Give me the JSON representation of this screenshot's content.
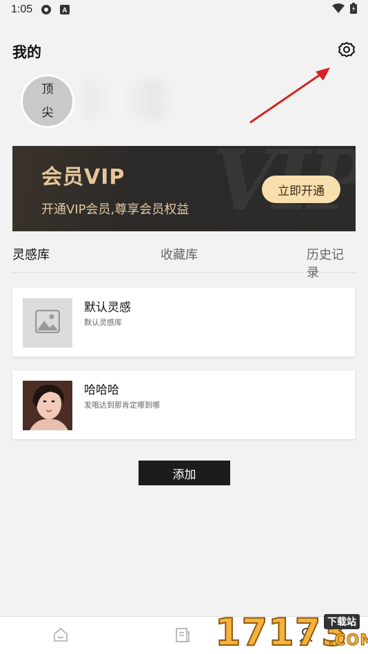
{
  "status_bar": {
    "time": "1:05",
    "icons": [
      "settings-gear-status-icon",
      "a-box-status-icon"
    ],
    "right_icons": [
      "wifi-icon",
      "battery-icon"
    ]
  },
  "header": {
    "title": "我的",
    "settings_icon": "gear-icon"
  },
  "profile": {
    "avatar_text_line1": "顶",
    "avatar_text_line2": "尖"
  },
  "vip_banner": {
    "title": "会员VIP",
    "subtitle": "开通VIP会员,尊享会员权益",
    "button_label": "立即开通",
    "watermark": "VIP",
    "accent_color": "#e6c79a",
    "button_color": "#f8dfae"
  },
  "tabs": [
    {
      "label": "灵感库",
      "active": true
    },
    {
      "label": "收藏库",
      "active": false
    },
    {
      "label": "历史记录",
      "active": false
    }
  ],
  "cards": [
    {
      "title": "默认灵感",
      "description": "默认灵感库",
      "thumbnail": "image-placeholder-icon"
    },
    {
      "title": "哈哈哈",
      "description": "发哦达到那肯定哪到哪",
      "thumbnail": "portrait-photo"
    }
  ],
  "add_button": {
    "label": "添加"
  },
  "bottom_nav": {
    "items": [
      {
        "icon": "home-icon"
      },
      {
        "icon": "document-icon"
      },
      {
        "icon": "profile-icon"
      }
    ]
  },
  "watermark": {
    "digits": "17173",
    "tag": "下载站",
    "suffix": ".COM"
  }
}
